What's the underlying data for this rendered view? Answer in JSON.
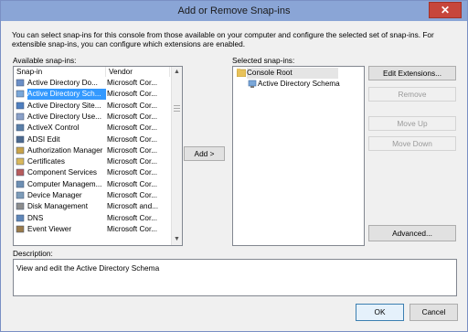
{
  "window": {
    "title": "Add or Remove Snap-ins",
    "close_glyph": "✕"
  },
  "intro_text": "You can select snap-ins for this console from those available on your computer and configure the selected set of snap-ins. For extensible snap-ins, you can configure which extensions are enabled.",
  "available": {
    "label": "Available snap-ins:",
    "col_snapin": "Snap-in",
    "col_vendor": "Vendor",
    "selected_index": 1,
    "items": [
      {
        "name": "Active Directory Do...",
        "vendor": "Microsoft Cor...",
        "icon": "ad-domains-icon"
      },
      {
        "name": "Active Directory Sch...",
        "vendor": "Microsoft Cor...",
        "icon": "ad-schema-icon"
      },
      {
        "name": "Active Directory Site...",
        "vendor": "Microsoft Cor...",
        "icon": "ad-sites-icon"
      },
      {
        "name": "Active Directory Use...",
        "vendor": "Microsoft Cor...",
        "icon": "ad-users-icon"
      },
      {
        "name": "ActiveX Control",
        "vendor": "Microsoft Cor...",
        "icon": "activex-icon"
      },
      {
        "name": "ADSI Edit",
        "vendor": "Microsoft Cor...",
        "icon": "adsi-edit-icon"
      },
      {
        "name": "Authorization Manager",
        "vendor": "Microsoft Cor...",
        "icon": "authorization-manager-icon"
      },
      {
        "name": "Certificates",
        "vendor": "Microsoft Cor...",
        "icon": "certificates-icon"
      },
      {
        "name": "Component Services",
        "vendor": "Microsoft Cor...",
        "icon": "component-services-icon"
      },
      {
        "name": "Computer Managem...",
        "vendor": "Microsoft Cor...",
        "icon": "computer-management-icon"
      },
      {
        "name": "Device Manager",
        "vendor": "Microsoft Cor...",
        "icon": "device-manager-icon"
      },
      {
        "name": "Disk Management",
        "vendor": "Microsoft and...",
        "icon": "disk-management-icon"
      },
      {
        "name": "DNS",
        "vendor": "Microsoft Cor...",
        "icon": "dns-icon"
      },
      {
        "name": "Event Viewer",
        "vendor": "Microsoft Cor...",
        "icon": "event-viewer-icon"
      }
    ]
  },
  "add_button": "Add >",
  "selected": {
    "label": "Selected snap-ins:",
    "root": "Console Root",
    "child": "Active Directory Schema"
  },
  "buttons": {
    "edit_extensions": "Edit Extensions...",
    "remove": "Remove",
    "move_up": "Move Up",
    "move_down": "Move Down",
    "advanced": "Advanced...",
    "ok": "OK",
    "cancel": "Cancel"
  },
  "description": {
    "label": "Description:",
    "text": "View and edit the Active Directory Schema"
  },
  "colors": {
    "selection": "#3399ff",
    "titlebar": "#8aa5d6",
    "close": "#c7463b"
  }
}
